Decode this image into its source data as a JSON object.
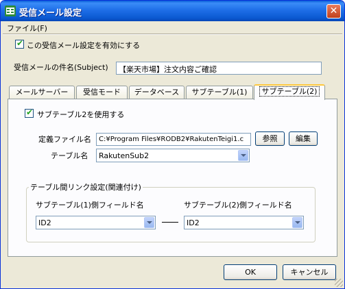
{
  "window": {
    "title": "受信メール設定",
    "close_glyph": "✕"
  },
  "menu": {
    "file_label": "ファイル(F)"
  },
  "enable_checkbox": {
    "label": "この受信メール設定を有効にする",
    "checked": true
  },
  "subject": {
    "label": "受信メールの件名(Subject)",
    "value": "【楽天市場】注文内容ご確認"
  },
  "tabs": [
    {
      "label": "メールサーバー",
      "active": false
    },
    {
      "label": "受信モード",
      "active": false
    },
    {
      "label": "データベース",
      "active": false
    },
    {
      "label": "サブテーブル(1)",
      "active": false
    },
    {
      "label": "サブテーブル(2)",
      "active": true
    }
  ],
  "panel": {
    "use_checkbox_label": "サブテーブル2を使用する",
    "use_checked": true,
    "def_file_label": "定義ファイル名",
    "def_file_value": "C:¥Program Files¥RODB2¥RakutenTeigi1.c",
    "browse_button": "参照",
    "edit_button": "編集",
    "table_label": "テーブル名",
    "table_value": "RakutenSub2",
    "group_title": "テーブル間リンク設定(関連付け)",
    "field1_label": "サブテーブル(1)側フィールド名",
    "field1_value": "ID2",
    "field2_label": "サブテーブル(2)側フィールド名",
    "field2_value": "ID2"
  },
  "buttons": {
    "ok": "OK",
    "cancel": "キャンセル"
  },
  "colors": {
    "titlebar": "#0a58d0",
    "dialog_bg": "#ece9d8",
    "active_tab_accent": "#ffc83c",
    "check_mark": "#21a121"
  }
}
